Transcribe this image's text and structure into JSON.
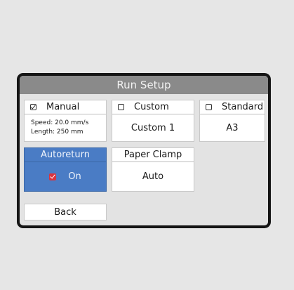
{
  "window": {
    "title": "Run Setup"
  },
  "modes": {
    "manual": {
      "label": "Manual",
      "checked": true,
      "speed_text": "Speed: 20.0 mm/s",
      "length_text": "Length: 250 mm"
    },
    "custom": {
      "label": "Custom",
      "checked": false,
      "value": "Custom 1"
    },
    "standard": {
      "label": "Standard",
      "checked": false,
      "value": "A3"
    }
  },
  "autoreturn": {
    "label": "Autoreturn",
    "value": "On",
    "checked": true,
    "color": "#4a7cc5",
    "check_color": "#d9343f"
  },
  "paper_clamp": {
    "label": "Paper Clamp",
    "value": "Auto"
  },
  "back": {
    "label": "Back"
  }
}
